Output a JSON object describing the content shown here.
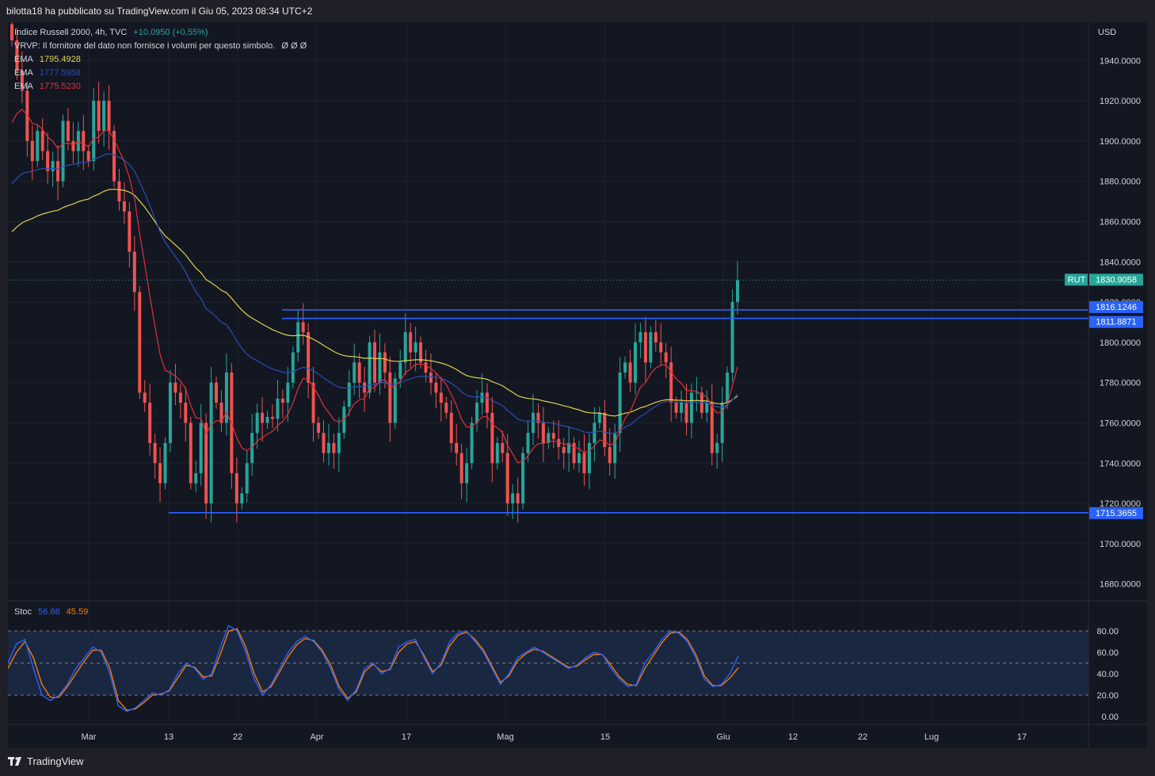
{
  "header": {
    "publisher": "bilotta18 ha pubblicato su TradingView.com il Giu 05, 2023 08:34 UTC+2"
  },
  "legend": {
    "symbol_line": "Indice Russell 2000, 4h, TVC",
    "change": "+10.0950 (+0.55%)",
    "vrvp": "VRVP: Il fornitore del dato non fornisce i volumi per questo simbolo.",
    "vrvp_icons": "Ø Ø Ø",
    "ema_label": "EMA",
    "ema1_value": "1795.4928",
    "ema2_value": "1777.5958",
    "ema3_value": "1775.5230",
    "stoch_label": "Stoc",
    "stoch_k": "56.68",
    "stoch_d": "45.59"
  },
  "colors": {
    "up": "#26a69a",
    "down": "#ef5350",
    "ema1": "#e3d24a",
    "ema2": "#2a4fb3",
    "ema3": "#e0303b",
    "hline": "#2962ff",
    "stoch_k": "#2962ff",
    "stoch_d": "#f57c00"
  },
  "footer": {
    "brand": "TradingView"
  },
  "chart_data": [
    {
      "type": "candlestick",
      "title": "Indice Russell 2000, 4h, TVC",
      "currency": "USD",
      "ylim": [
        1672,
        1959
      ],
      "y_ticks": [
        "1940.0000",
        "1920.0000",
        "1900.0000",
        "1880.0000",
        "1860.0000",
        "1840.0000",
        "1820.0000",
        "1800.0000",
        "1780.0000",
        "1760.0000",
        "1740.0000",
        "1720.0000",
        "1700.0000",
        "1680.0000"
      ],
      "x_ticks": [
        "Mar",
        "13",
        "22",
        "Apr",
        "17",
        "Mag",
        "15",
        "Giu",
        "12",
        "22",
        "Lug",
        "17"
      ],
      "last_price": {
        "label": "RUT",
        "value": "1830.9058"
      },
      "horizontal_lines": [
        {
          "value": 1816.1246,
          "label": "1816.1246"
        },
        {
          "value": 1811.8871,
          "label": "1811.8871"
        },
        {
          "value": 1715.3655,
          "label": "1715.3655"
        }
      ],
      "closes": [
        1950,
        1935,
        1925,
        1900,
        1890,
        1905,
        1895,
        1885,
        1890,
        1880,
        1910,
        1900,
        1895,
        1905,
        1895,
        1890,
        1920,
        1905,
        1920,
        1905,
        1880,
        1870,
        1865,
        1845,
        1825,
        1775,
        1770,
        1750,
        1740,
        1730,
        1750,
        1780,
        1775,
        1770,
        1760,
        1730,
        1735,
        1760,
        1720,
        1780,
        1770,
        1760,
        1785,
        1735,
        1720,
        1725,
        1740,
        1755,
        1765,
        1760,
        1763,
        1762,
        1772,
        1770,
        1780,
        1795,
        1810,
        1805,
        1780,
        1760,
        1755,
        1745,
        1750,
        1745,
        1755,
        1768,
        1780,
        1790,
        1780,
        1775,
        1800,
        1780,
        1795,
        1785,
        1760,
        1782,
        1790,
        1805,
        1795,
        1800,
        1790,
        1785,
        1780,
        1775,
        1770,
        1765,
        1750,
        1745,
        1730,
        1740,
        1760,
        1770,
        1775,
        1765,
        1740,
        1750,
        1745,
        1720,
        1725,
        1720,
        1745,
        1755,
        1765,
        1760,
        1750,
        1755,
        1752,
        1748,
        1745,
        1750,
        1740,
        1745,
        1735,
        1750,
        1760,
        1765,
        1748,
        1740,
        1755,
        1785,
        1790,
        1780,
        1800,
        1805,
        1790,
        1805,
        1800,
        1795,
        1790,
        1770,
        1765,
        1770,
        1760,
        1775,
        1775,
        1765,
        1770,
        1745,
        1750,
        1770,
        1785,
        1820,
        1830.9
      ],
      "ema_lines": [
        {
          "name": "EMA 1795.4928",
          "start": 1852,
          "end": 1795.49
        },
        {
          "name": "EMA 1777.5958",
          "start": 1875,
          "end": 1777.6
        },
        {
          "name": "EMA 1775.5230",
          "start": 1900,
          "end": 1775.52
        }
      ]
    },
    {
      "type": "line",
      "title": "Stoc",
      "ylim": [
        0,
        100
      ],
      "y_ticks": [
        "80.00",
        "60.00",
        "40.00",
        "20.00",
        "0.00"
      ],
      "band": [
        20,
        80
      ],
      "series": [
        {
          "name": "56.68",
          "last": 56.68
        },
        {
          "name": "45.59",
          "last": 45.59
        }
      ],
      "k_values": [
        50,
        68,
        72,
        45,
        20,
        15,
        20,
        30,
        45,
        55,
        65,
        60,
        40,
        10,
        5,
        8,
        15,
        22,
        20,
        25,
        40,
        50,
        45,
        35,
        40,
        65,
        85,
        80,
        60,
        35,
        20,
        30,
        45,
        60,
        70,
        75,
        70,
        60,
        45,
        25,
        15,
        25,
        45,
        50,
        40,
        45,
        65,
        70,
        72,
        55,
        40,
        50,
        70,
        78,
        80,
        70,
        60,
        45,
        30,
        40,
        55,
        60,
        65,
        60,
        55,
        50,
        45,
        48,
        55,
        60,
        58,
        45,
        35,
        28,
        30,
        50,
        60,
        72,
        80,
        78,
        70,
        55,
        35,
        28,
        30,
        40,
        56.68
      ],
      "d_values": [
        45,
        60,
        70,
        55,
        30,
        18,
        18,
        28,
        40,
        52,
        62,
        62,
        45,
        15,
        6,
        7,
        13,
        20,
        21,
        24,
        36,
        48,
        46,
        37,
        38,
        58,
        80,
        82,
        65,
        40,
        23,
        28,
        42,
        56,
        67,
        73,
        71,
        62,
        48,
        28,
        17,
        23,
        42,
        49,
        42,
        44,
        60,
        68,
        70,
        57,
        42,
        48,
        66,
        76,
        79,
        72,
        62,
        47,
        32,
        38,
        52,
        59,
        63,
        61,
        56,
        51,
        46,
        47,
        53,
        58,
        58,
        48,
        37,
        30,
        29,
        45,
        57,
        69,
        78,
        79,
        72,
        58,
        38,
        29,
        29,
        36,
        45.59
      ]
    }
  ]
}
